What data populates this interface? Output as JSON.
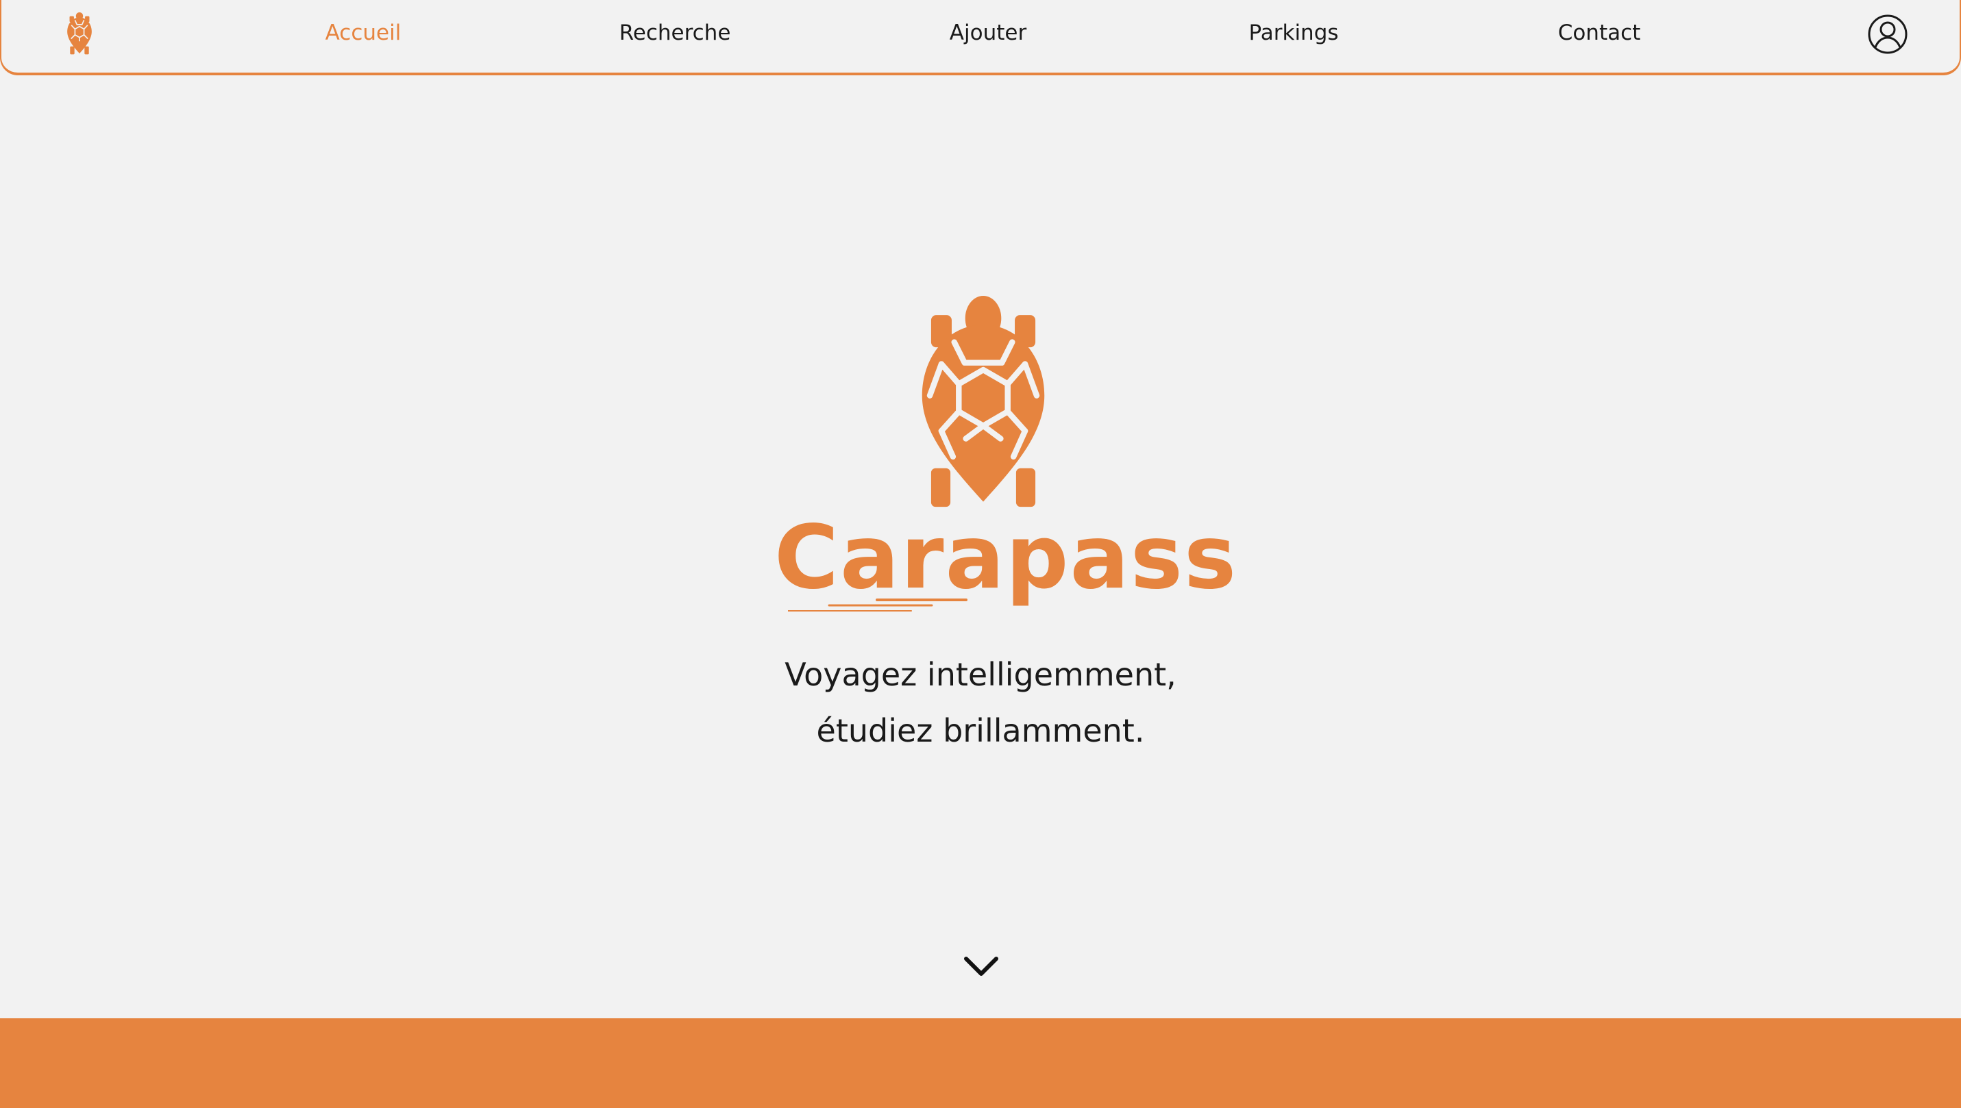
{
  "colors": {
    "accent": "#e6843f",
    "background": "#f2f2f2",
    "text": "#1a1a1a"
  },
  "nav": {
    "logo_icon": "turtle-logo-icon",
    "items": [
      {
        "label": "Accueil",
        "active": true
      },
      {
        "label": "Recherche",
        "active": false
      },
      {
        "label": "Ajouter",
        "active": false
      },
      {
        "label": "Parkings",
        "active": false
      },
      {
        "label": "Contact",
        "active": false
      }
    ],
    "profile_icon": "user-circle-icon"
  },
  "hero": {
    "logo_icon": "turtle-logo-icon",
    "brand": "Carapass",
    "tagline_line1": "Voyagez intelligemment,",
    "tagline_line2": "étudiez brillamment.",
    "scroll_icon": "chevron-down-icon"
  }
}
